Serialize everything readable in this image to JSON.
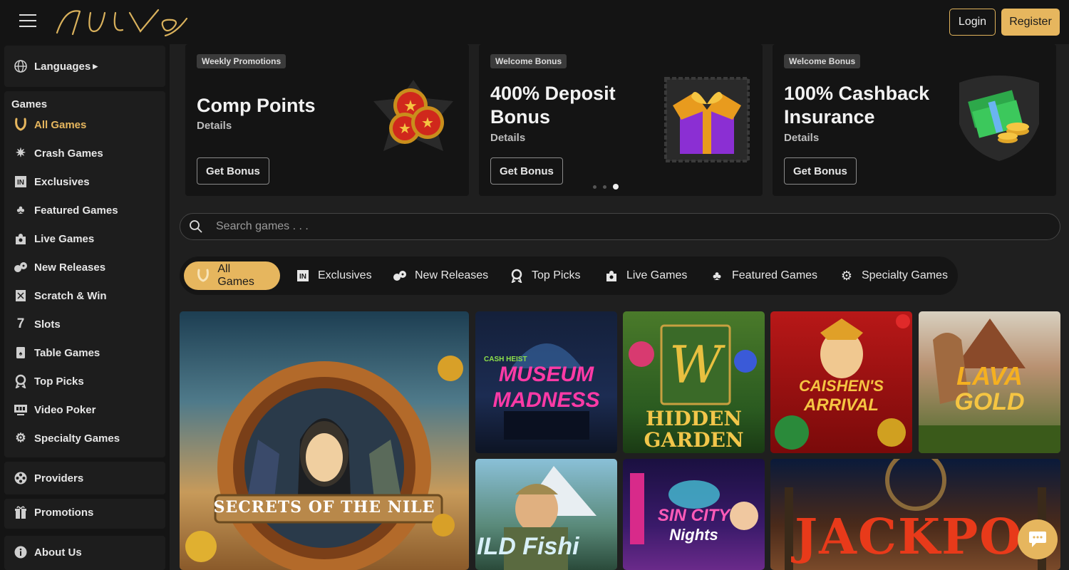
{
  "header": {
    "logo_text": "New Vegas",
    "login_label": "Login",
    "register_label": "Register"
  },
  "sidebar": {
    "languages_label": "Languages",
    "games_heading": "Games",
    "items": [
      {
        "label": "All Games",
        "icon": "horseshoe-icon",
        "active": true
      },
      {
        "label": "Crash Games",
        "icon": "explosion-icon"
      },
      {
        "label": "Exclusives",
        "icon": "exclusive-badge-icon"
      },
      {
        "label": "Featured Games",
        "icon": "clover-icon"
      },
      {
        "label": "Live Games",
        "icon": "live-dealer-icon"
      },
      {
        "label": "New Releases",
        "icon": "dice-icon"
      },
      {
        "label": "Scratch & Win",
        "icon": "scratch-card-icon"
      },
      {
        "label": "Slots",
        "icon": "seven-icon"
      },
      {
        "label": "Table Games",
        "icon": "card-icon"
      },
      {
        "label": "Top Picks",
        "icon": "award-icon"
      },
      {
        "label": "Video Poker",
        "icon": "video-poker-icon"
      },
      {
        "label": "Specialty Games",
        "icon": "gear-icon"
      }
    ],
    "providers_label": "Providers",
    "promotions_label": "Promotions",
    "about_label": "About Us"
  },
  "promos": [
    {
      "tag": "Weekly Promotions",
      "title": "Comp Points",
      "details": "Details",
      "button": "Get Bonus",
      "art": "gold-coins"
    },
    {
      "tag": "Welcome Bonus",
      "title": "400% Deposit Bonus",
      "details": "Details",
      "button": "Get Bonus",
      "art": "gift-box"
    },
    {
      "tag": "Welcome Bonus",
      "title": "100% Cashback Insurance",
      "details": "Details",
      "button": "Get Bonus",
      "art": "money-shield"
    }
  ],
  "carousel": {
    "count": 3,
    "active_index": 2
  },
  "search": {
    "placeholder": "Search games . . ."
  },
  "tabs": [
    {
      "label": "All Games",
      "icon": "horseshoe-icon",
      "active": true
    },
    {
      "label": "Exclusives",
      "icon": "exclusive-badge-icon"
    },
    {
      "label": "New Releases",
      "icon": "dice-icon"
    },
    {
      "label": "Top Picks",
      "icon": "award-icon"
    },
    {
      "label": "Live Games",
      "icon": "live-dealer-icon"
    },
    {
      "label": "Featured Games",
      "icon": "clover-icon"
    },
    {
      "label": "Specialty Games",
      "icon": "gear-icon"
    }
  ],
  "games": [
    {
      "title": "SECRETS OF THE NILE",
      "title_small": "of the"
    },
    {
      "title_top": "CASH HEIST",
      "title_line1": "MUSEUM",
      "title_line2": "MADNESS"
    },
    {
      "title_line1": "HIDDEN",
      "title_line2": "GARDEN"
    },
    {
      "title_line1": "CAISHEN'S",
      "title_line2": "ARRIVAL"
    },
    {
      "title_line1": "LAVA",
      "title_line2": "GOLD"
    },
    {
      "title": "ILD Fishi"
    },
    {
      "title_line1": "SIN CITY",
      "title_line2": "Nights"
    },
    {
      "title": "JACKPO"
    }
  ],
  "colors": {
    "accent": "#e6b65e",
    "background": "#1f1f1f",
    "panel": "#141414"
  }
}
